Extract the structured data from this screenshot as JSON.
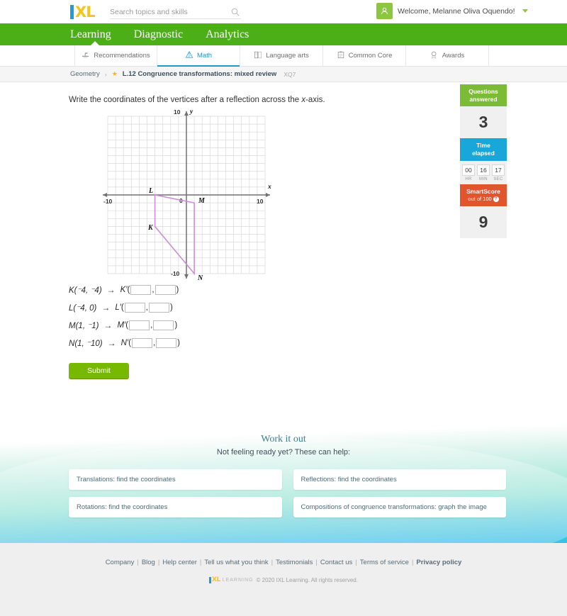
{
  "header": {
    "logo_text": "XL",
    "search_placeholder": "Search topics and skills",
    "search_value": "",
    "welcome_text": "Welcome, Melanne Oliva Oquendo!"
  },
  "nav": {
    "items": [
      {
        "label": "Learning",
        "active": true
      },
      {
        "label": "Diagnostic",
        "active": false
      },
      {
        "label": "Analytics",
        "active": false
      }
    ]
  },
  "subnav": {
    "tabs": [
      {
        "label": "Recommendations",
        "icon": "recommendations-icon",
        "active": false
      },
      {
        "label": "Math",
        "icon": "math-icon",
        "active": true
      },
      {
        "label": "Language arts",
        "icon": "book-icon",
        "active": false
      },
      {
        "label": "Common Core",
        "icon": "clipboard-icon",
        "active": false
      },
      {
        "label": "Awards",
        "icon": "award-icon",
        "active": false
      }
    ]
  },
  "breadcrumb": {
    "parent": "Geometry",
    "separator": "›",
    "current": "L.12 Congruence transformations: mixed review",
    "code": "XQ7"
  },
  "question": {
    "prefix": "Write the coordinates of the vertices after a reflection across the ",
    "italic": "x",
    "suffix": "-axis."
  },
  "chart_data": {
    "type": "scatter",
    "title": "",
    "xlabel": "x",
    "ylabel": "y",
    "xlim": [
      -10,
      10
    ],
    "ylim": [
      -10,
      10
    ],
    "grid": true,
    "x_tick_labels": [
      "-10",
      "0",
      "10"
    ],
    "y_tick_labels": [
      "10",
      "-10"
    ],
    "origin_label": "0",
    "shape_color": "#cc8fd6",
    "vertices": [
      {
        "label": "K",
        "x": -4,
        "y": -4
      },
      {
        "label": "L",
        "x": -4,
        "y": 0
      },
      {
        "label": "M",
        "x": 1,
        "y": -1
      },
      {
        "label": "N",
        "x": 1,
        "y": -10
      }
    ],
    "polygon_order": [
      "L",
      "M",
      "N",
      "K"
    ]
  },
  "answers": {
    "rows": [
      {
        "label": "K",
        "coords": "(⁻4, ⁻4)",
        "image_label": "K′"
      },
      {
        "label": "L",
        "coords": "(⁻4, 0)",
        "image_label": "L′"
      },
      {
        "label": "M",
        "coords": "(1, ⁻1)",
        "image_label": "M′"
      },
      {
        "label": "N",
        "coords": "(1, ⁻10)",
        "image_label": "N′"
      }
    ],
    "arrow": "→",
    "open_paren": "(",
    "comma": ",",
    "close_paren": ")",
    "input_value": ""
  },
  "submit": {
    "label": "Submit"
  },
  "scorepanel": {
    "questions_answered_label": "Questions\nanswered",
    "questions_answered_value": "3",
    "time_elapsed_label": "Time\nelapsed",
    "time": {
      "hr": "00",
      "min": "16",
      "sec": "17",
      "hr_unit": "HR",
      "min_unit": "MIN",
      "sec_unit": "SEC"
    },
    "smartscore_label": "SmartScore",
    "smartscore_sub": "out of 100",
    "smartscore_value": "9",
    "help_glyph": "?"
  },
  "workitout": {
    "title": "Work it out",
    "subtitle": "Not feeling ready yet? These can help:",
    "cards": [
      "Translations: find the coordinates",
      "Reflections: find the coordinates",
      "Rotations: find the coordinates",
      "Compositions of congruence transformations: graph the image"
    ]
  },
  "footer": {
    "links": [
      {
        "label": "Company",
        "bold": false
      },
      {
        "label": "Blog",
        "bold": false
      },
      {
        "label": "Help center",
        "bold": false
      },
      {
        "label": "Tell us what you think",
        "bold": false
      },
      {
        "label": "Testimonials",
        "bold": false
      },
      {
        "label": "Contact us",
        "bold": false
      },
      {
        "label": "Terms of service",
        "bold": false
      },
      {
        "label": "Privacy policy",
        "bold": true
      }
    ],
    "logo_word": "LEARNING",
    "copyright": "© 2020 IXL Learning. All rights reserved."
  }
}
